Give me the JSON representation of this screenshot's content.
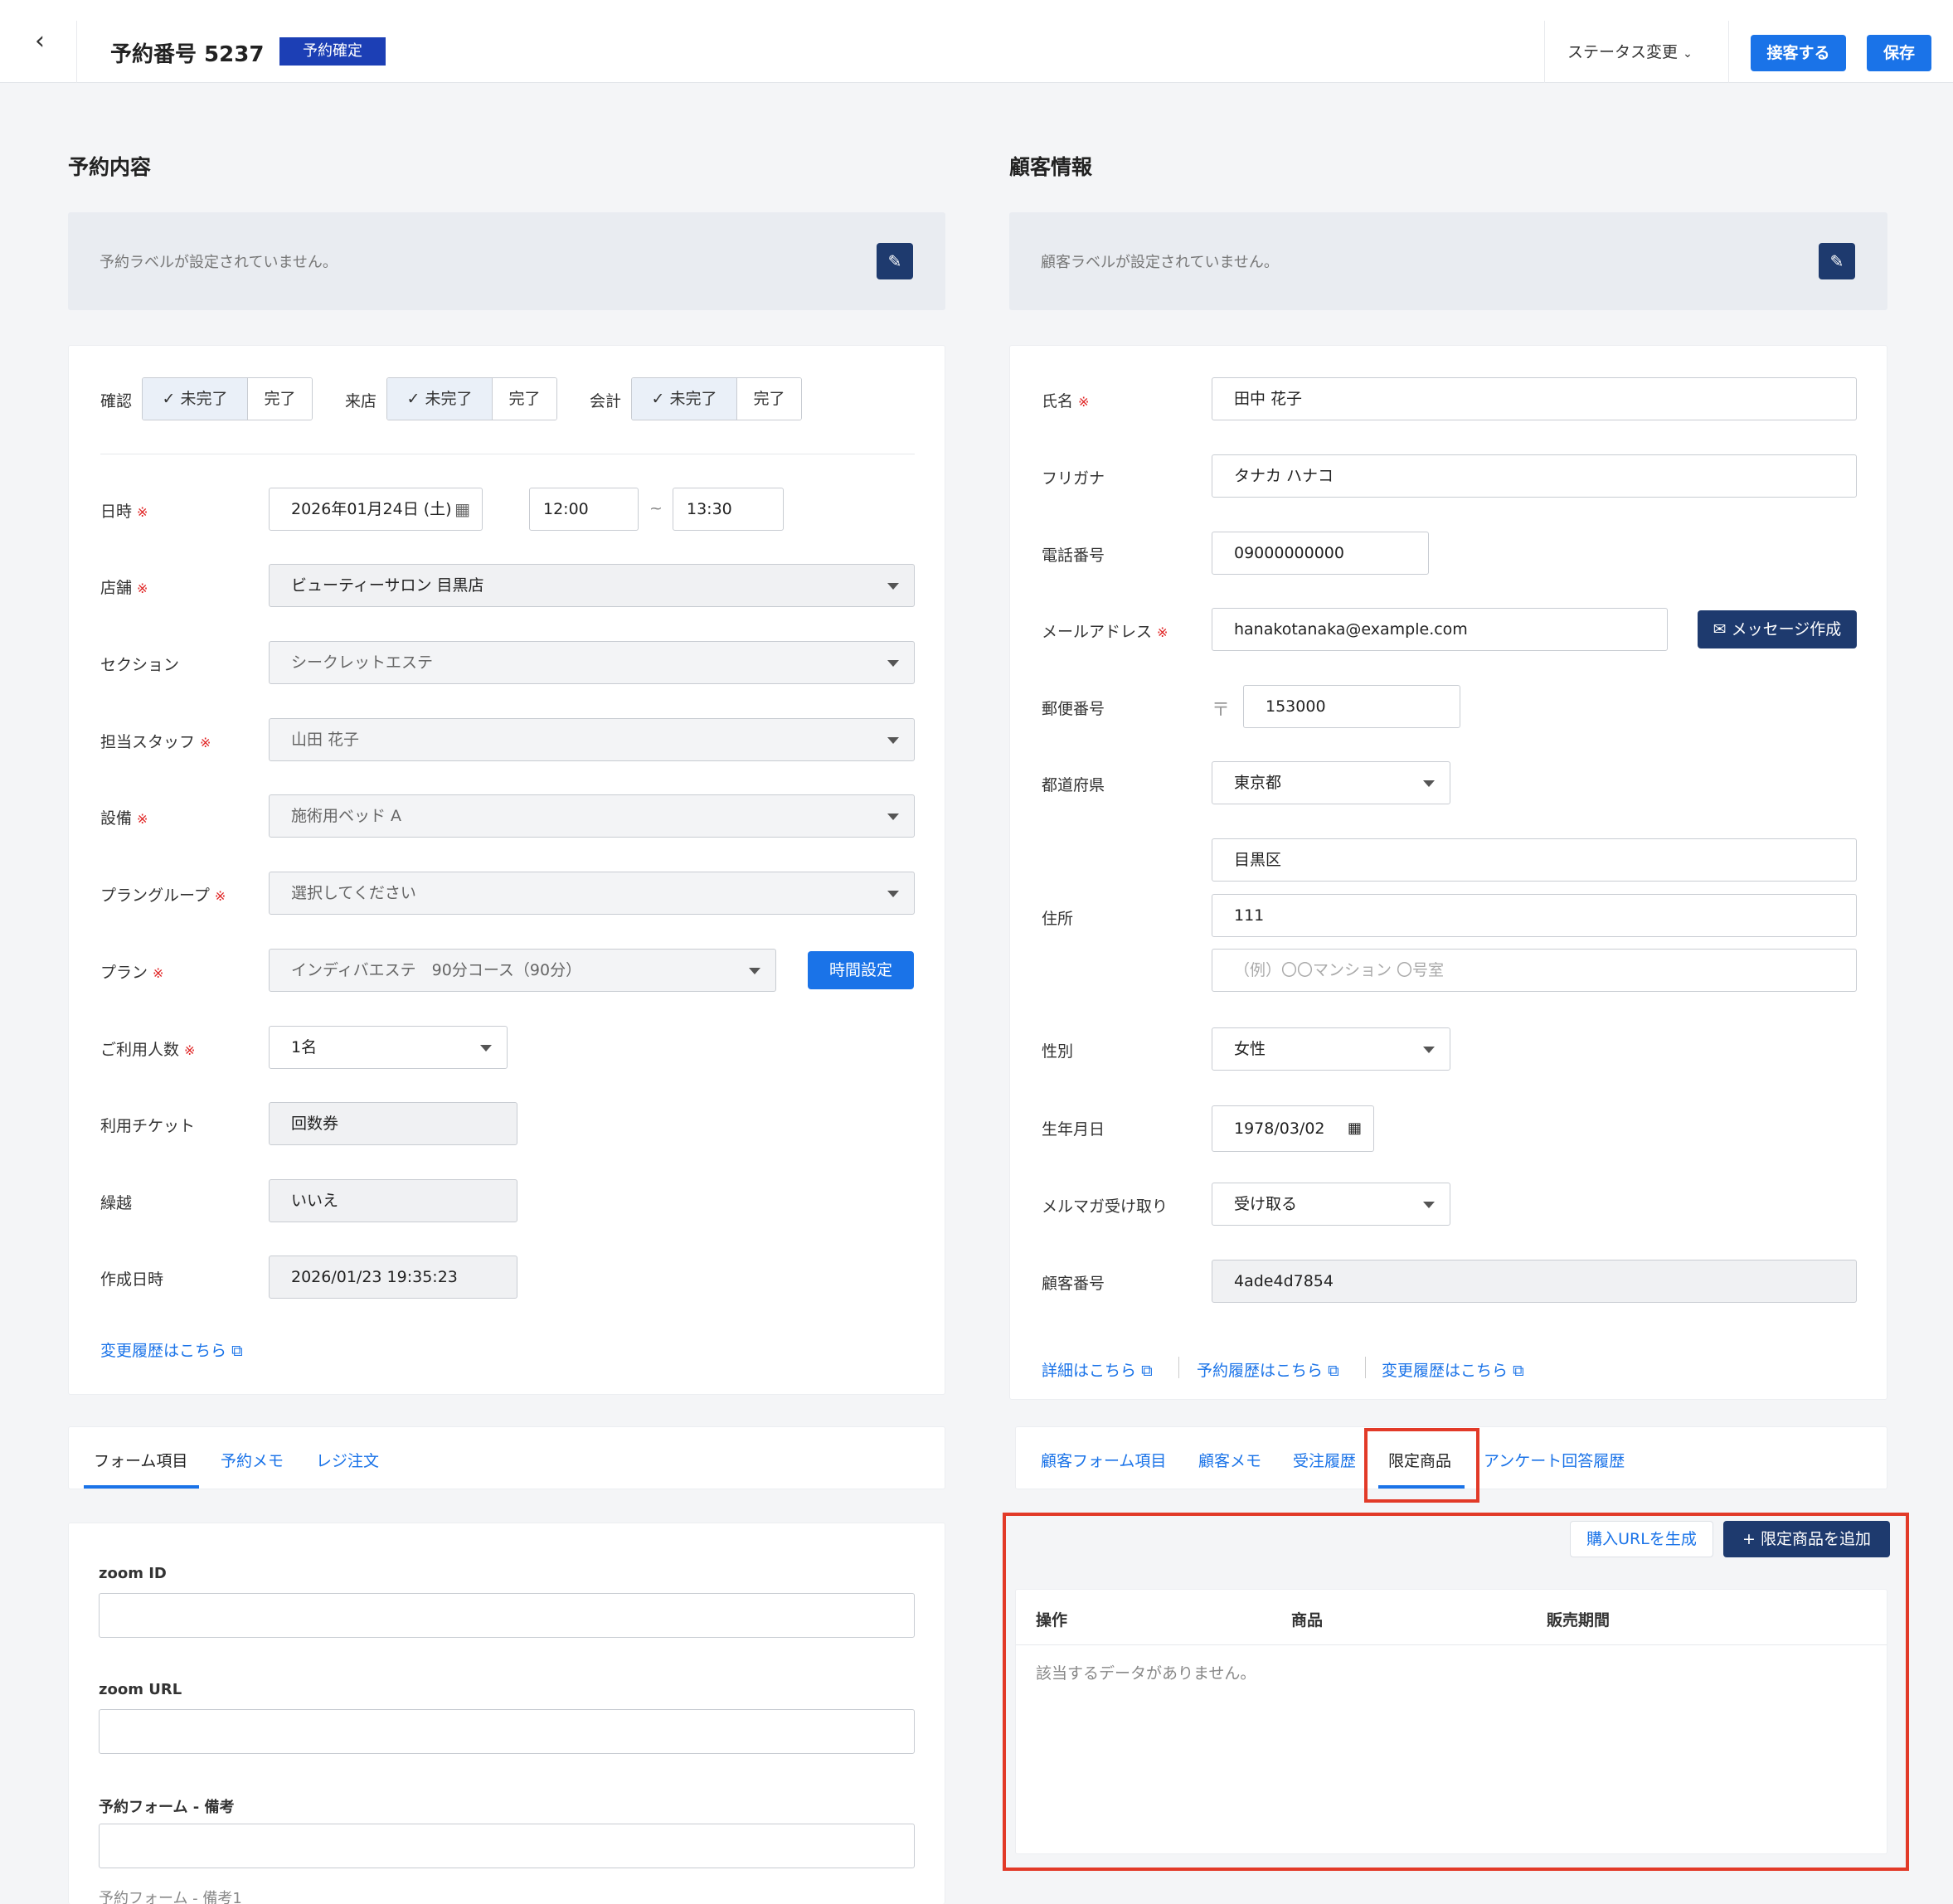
{
  "header": {
    "back_icon": "chevron-left-icon",
    "title": "予約番号 5237",
    "status_badge": "予約確定",
    "status_change": "ステータス変更",
    "serve_button": "接客する",
    "save_button": "保存"
  },
  "reservation": {
    "section_title": "予約内容",
    "label_placeholder": "予約ラベルが設定されていません。",
    "toggles": [
      {
        "label": "確認",
        "on": "未完了",
        "off": "完了"
      },
      {
        "label": "来店",
        "on": "未完了",
        "off": "完了"
      },
      {
        "label": "会計",
        "on": "未完了",
        "off": "完了"
      }
    ],
    "datetime_label": "日時",
    "date": "2026年01月24日 (土)",
    "start_time": "12:00",
    "tilde": "~",
    "end_time": "13:30",
    "store_label": "店舗",
    "store": "ビューティーサロン 目黒店",
    "section_label": "セクション",
    "section": "シークレットエステ",
    "staff_label": "担当スタッフ",
    "staff": "山田 花子",
    "equipment_label": "設備",
    "equipment": "施術用ベッド A",
    "plan_group_label": "プラングループ",
    "plan_group": "選択してください",
    "plan_label": "プラン",
    "plan": "インディバエステ　90分コース（90分）",
    "time_setting_button": "時間設定",
    "people_label": "ご利用人数",
    "people": "1名",
    "ticket_label": "利用チケット",
    "ticket": "回数券",
    "carryover_label": "繰越",
    "carryover": "いいえ",
    "created_label": "作成日時",
    "created": "2026/01/23 19:35:23",
    "history_link": "変更履歴はこちら",
    "required_mark": "※"
  },
  "reservation_tabs": {
    "tabs": [
      "フォーム項目",
      "予約メモ",
      "レジ注文"
    ]
  },
  "form_items": {
    "zoom_id_label": "zoom ID",
    "zoom_url_label": "zoom URL",
    "memo_label": "予約フォーム - 備考",
    "memo1_label": "予約フォーム - 備考1"
  },
  "customer": {
    "section_title": "顧客情報",
    "label_placeholder": "顧客ラベルが設定されていません。",
    "name_label": "氏名",
    "name": "田中 花子",
    "kana_label": "フリガナ",
    "kana": "タナカ ハナコ",
    "phone_label": "電話番号",
    "phone": "09000000000",
    "email_label": "メールアドレス",
    "email": "hanakotanaka@example.com",
    "message_button": "メッセージ作成",
    "zip_label": "郵便番号",
    "zip_mark": "〒",
    "zip": "153000",
    "pref_label": "都道府県",
    "pref": "東京都",
    "address_label": "住所",
    "address1": "目黒区",
    "address2": "111",
    "address3_placeholder": "（例）〇〇マンション 〇号室",
    "gender_label": "性別",
    "gender": "女性",
    "birth_label": "生年月日",
    "birth": "1978/03/02",
    "newsletter_label": "メルマガ受け取り",
    "newsletter": "受け取る",
    "customer_no_label": "顧客番号",
    "customer_no": "4ade4d7854",
    "links": [
      "詳細はこちら",
      "予約履歴はこちら",
      "変更履歴はこちら"
    ]
  },
  "customer_tabs": {
    "tabs": [
      "顧客フォーム項目",
      "顧客メモ",
      "受注履歴",
      "限定商品",
      "アンケート回答履歴"
    ],
    "active": "限定商品"
  },
  "limited": {
    "generate_url_button": "購入URLを生成",
    "add_button": "限定商品を追加",
    "columns": [
      "操作",
      "商品",
      "販売期間"
    ],
    "empty": "該当するデータがありません。"
  },
  "colors": {
    "primary": "#1a73e8",
    "navy": "#1e3a6e",
    "badge": "#1c3fb5",
    "highlight": "#e23a28"
  }
}
